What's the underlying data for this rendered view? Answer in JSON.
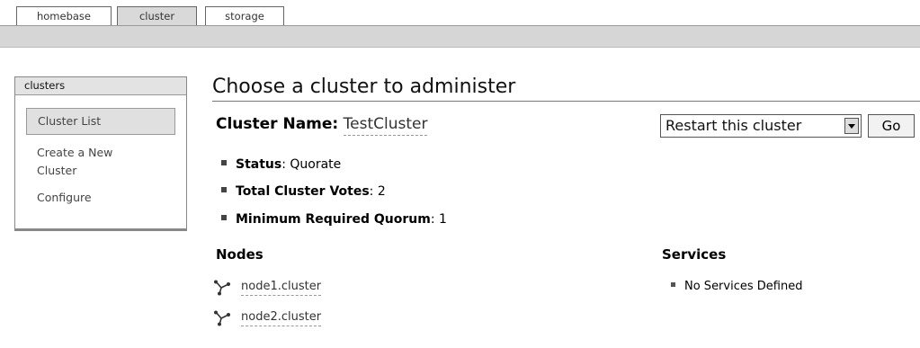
{
  "tabs": [
    {
      "label": "homebase",
      "active": false
    },
    {
      "label": "cluster",
      "active": true
    },
    {
      "label": "storage",
      "active": false
    }
  ],
  "sidebar": {
    "header": "clusters",
    "items": [
      {
        "label": "Cluster List",
        "active": true
      },
      {
        "label": "Create a New Cluster",
        "active": false
      },
      {
        "label": "Configure",
        "active": false
      }
    ]
  },
  "main": {
    "title": "Choose a cluster to administer",
    "cluster_name_label": "Cluster Name:",
    "cluster_name_value": "TestCluster",
    "action_select_value": "Restart this cluster",
    "go_label": "Go",
    "stats": [
      {
        "label": "Status",
        "value": ": Quorate"
      },
      {
        "label": "Total Cluster Votes",
        "value": ": 2"
      },
      {
        "label": "Minimum Required Quorum",
        "value": ": 1"
      }
    ],
    "nodes_heading": "Nodes",
    "nodes": [
      "node1.cluster",
      "node2.cluster"
    ],
    "services_heading": "Services",
    "services": [
      "No Services Defined"
    ]
  },
  "icons": {
    "node": "node-icon",
    "dropdown": "dropdown-arrow-icon"
  }
}
